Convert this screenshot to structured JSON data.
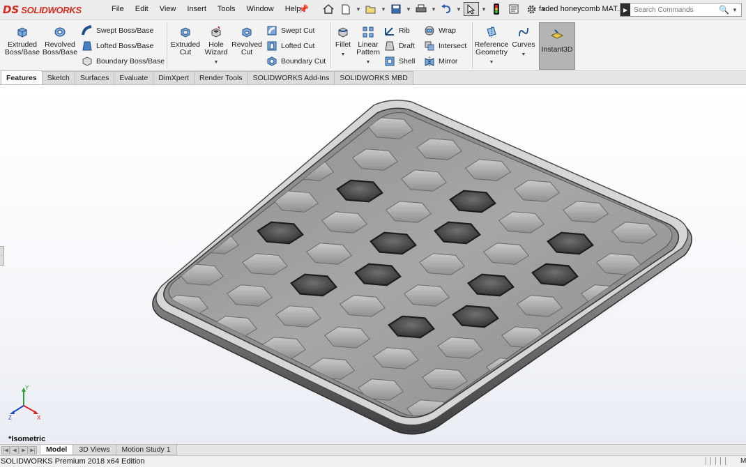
{
  "app": {
    "brand_mark": "DS",
    "brand_name": "SOLIDWORKS",
    "brand_color": "#d52b1e",
    "document_title": "faded honeycomb MAT..."
  },
  "menu": [
    "File",
    "Edit",
    "View",
    "Insert",
    "Tools",
    "Window",
    "Help"
  ],
  "search": {
    "placeholder": "Search Commands"
  },
  "ribbon": {
    "extruded_boss": "Extruded Boss/Base",
    "revolved_boss": "Revolved Boss/Base",
    "swept_boss": "Swept Boss/Base",
    "lofted_boss": "Lofted Boss/Base",
    "boundary_boss": "Boundary Boss/Base",
    "extruded_cut": "Extruded Cut",
    "hole_wizard": "Hole Wizard",
    "revolved_cut": "Revolved Cut",
    "swept_cut": "Swept Cut",
    "lofted_cut": "Lofted Cut",
    "boundary_cut": "Boundary Cut",
    "fillet": "Fillet",
    "linear_pattern": "Linear Pattern",
    "rib": "Rib",
    "draft": "Draft",
    "shell": "Shell",
    "wrap": "Wrap",
    "intersect": "Intersect",
    "mirror": "Mirror",
    "reference_geometry": "Reference Geometry",
    "curves": "Curves",
    "instant3d": "Instant3D"
  },
  "tabs": [
    "Features",
    "Sketch",
    "Surfaces",
    "Evaluate",
    "DimXpert",
    "Render Tools",
    "SOLIDWORKS Add-Ins",
    "SOLIDWORKS MBD"
  ],
  "active_tab": "Features",
  "viewport": {
    "view_name": "*Isometric"
  },
  "bottom_tabs": [
    "Model",
    "3D Views",
    "Motion Study 1"
  ],
  "status": {
    "left": "SOLIDWORKS Premium 2018 x64 Edition",
    "right": "M"
  }
}
